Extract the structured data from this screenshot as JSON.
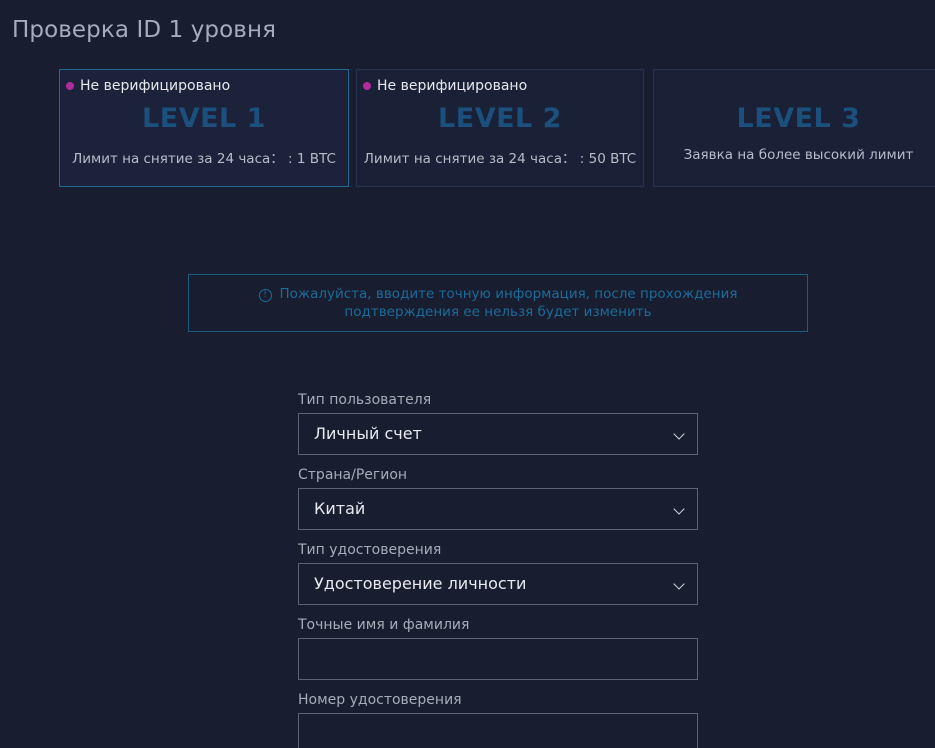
{
  "page_title": "Проверка ID 1 уровня",
  "levels": [
    {
      "status": "Не верифицировано",
      "name": "LEVEL 1",
      "limit": "Лимит на снятие за 24 часа： : 1 BTC"
    },
    {
      "status": "Не верифицировано",
      "name": "LEVEL 2",
      "limit": "Лимит на снятие за 24 часа： : 50 BTC"
    },
    {
      "status": "",
      "name": "LEVEL 3",
      "limit": "Заявка на более высокий лимит"
    }
  ],
  "notice": {
    "line1": "Пожалуйста, вводите точную информация, после прохождения",
    "line2": "подтверждения ее нельзя будет изменить"
  },
  "form": {
    "user_type": {
      "label": "Тип пользователя",
      "value": "Личный счет"
    },
    "country": {
      "label": "Страна/Регион",
      "value": "Китай"
    },
    "id_type": {
      "label": "Тип удостоверения",
      "value": "Удостоверение личности"
    },
    "full_name": {
      "label": "Точные имя и фамилия",
      "value": ""
    },
    "id_number": {
      "label": "Номер удостоверения",
      "value": ""
    }
  },
  "colors": {
    "background": "#181d30",
    "accent": "#1d6b98",
    "status_dot": "#b02c9e"
  },
  "icons": {
    "notice": "info-icon",
    "select": "chevron-down-icon"
  }
}
